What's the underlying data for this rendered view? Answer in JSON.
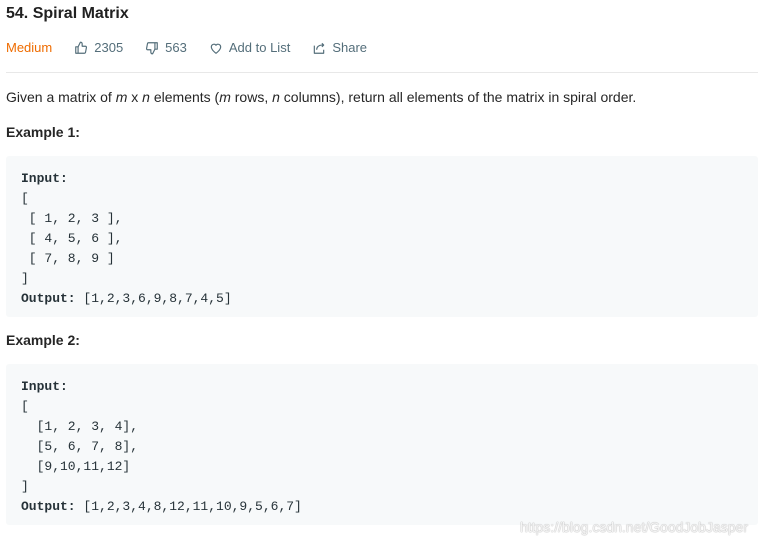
{
  "problem": {
    "title": "54. Spiral Matrix",
    "difficulty": "Medium",
    "likes": "2305",
    "dislikes": "563",
    "add_to_list": "Add to List",
    "share": "Share"
  },
  "description": {
    "part1": "Given a matrix of ",
    "m": "m",
    "part2": " x ",
    "n": "n",
    "part3": " elements (",
    "m2": "m",
    "part4": " rows, ",
    "n2": "n",
    "part5": " columns), return all elements of the matrix in spiral order."
  },
  "examples": [
    {
      "title": "Example 1:",
      "input_label": "Input:",
      "input_lines": [
        "[",
        " [ 1, 2, 3 ],",
        " [ 4, 5, 6 ],",
        " [ 7, 8, 9 ]",
        "]"
      ],
      "output_label": "Output:",
      "output_value": " [1,2,3,6,9,8,7,4,5]"
    },
    {
      "title": "Example 2:",
      "input_label": "Input:",
      "input_lines": [
        "[",
        "  [1, 2, 3, 4],",
        "  [5, 6, 7, 8],",
        "  [9,10,11,12]",
        "]"
      ],
      "output_label": "Output:",
      "output_value": " [1,2,3,4,8,12,11,10,9,5,6,7]"
    }
  ],
  "watermark": "https://blog.csdn.net/GoodJobJasper",
  "colors": {
    "difficulty": "#ef6c00",
    "meta_text": "#546e7a",
    "code_bg": "#f7f9fa"
  }
}
